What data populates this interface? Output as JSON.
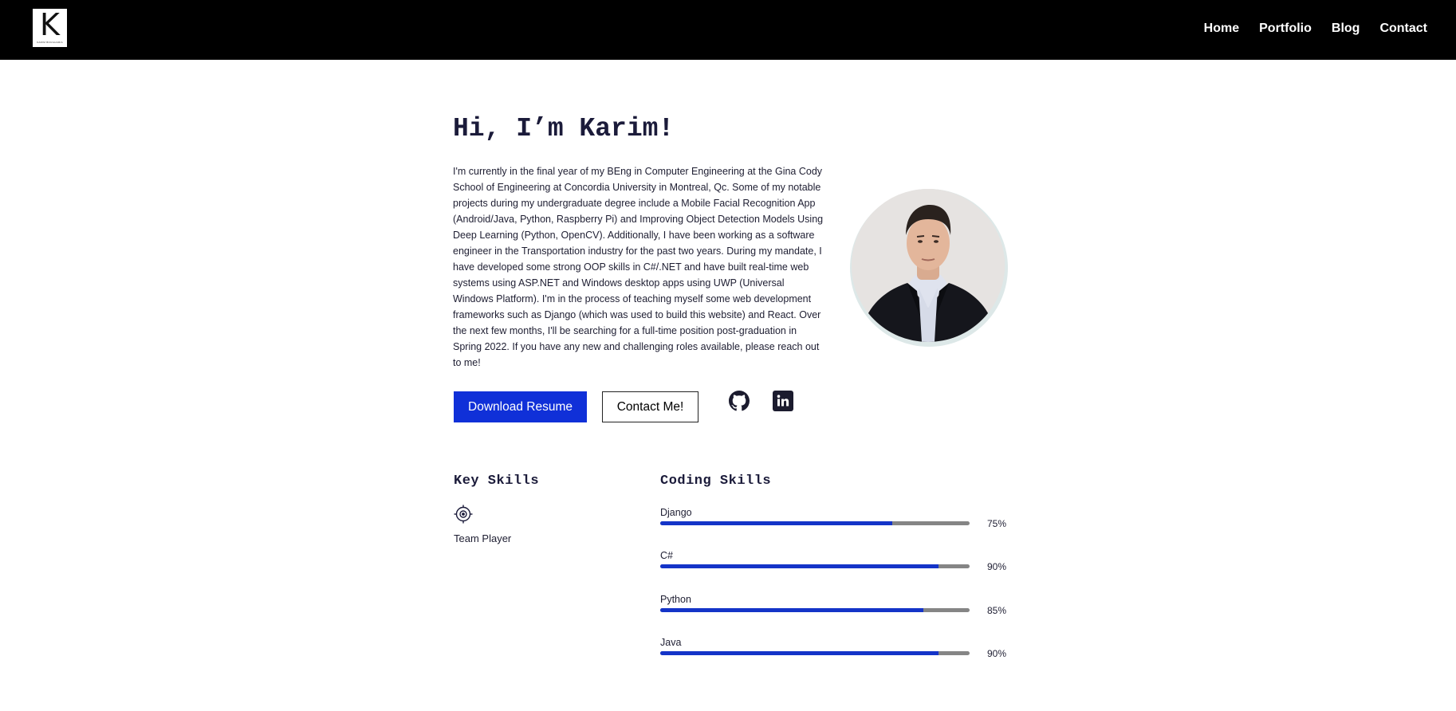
{
  "header": {
    "logo": {
      "letter": "K",
      "subtitle": "KARIM BOUGHARIA"
    },
    "nav": [
      "Home",
      "Portfolio",
      "Blog",
      "Contact"
    ]
  },
  "intro": {
    "title": "Hi, I’m Karim!",
    "bio": "I'm currently in the final year of my BEng in Computer Engineering at the Gina Cody School of Engineering at Concordia University in Montreal, Qc. Some of my notable projects during my undergraduate degree include a Mobile Facial Recognition App (Android/Java, Python, Raspberry Pi) and Improving Object Detection Models Using Deep Learning (Python, OpenCV). Additionally, I have been working as a software engineer in the Transportation industry for the past two years. During my mandate, I have developed some strong OOP skills in C#/.NET and have built real-time web systems using ASP.NET and Windows desktop apps using UWP (Universal Windows Platform). I'm in the process of teaching myself some web development frameworks such as Django (which was used to build this website) and React. Over the next few months, I'll be searching for a full-time position post-graduation in Spring 2022. If you have any new and challenging roles available, please reach out to me!",
    "buttons": {
      "download": "Download Resume",
      "contact": "Contact Me!"
    },
    "social_icons": [
      "github-icon",
      "linkedin-icon"
    ]
  },
  "key_skills": {
    "title": "Key Skills",
    "items": [
      {
        "icon": "target-icon",
        "label": "Team Player"
      }
    ]
  },
  "coding_skills": {
    "title": "Coding Skills",
    "items": [
      {
        "name": "Django",
        "percent": 75,
        "percent_label": "75%"
      },
      {
        "name": "C#",
        "percent": 90,
        "percent_label": "90%"
      },
      {
        "name": "Python",
        "percent": 85,
        "percent_label": "85%"
      },
      {
        "name": "Java",
        "percent": 90,
        "percent_label": "90%"
      }
    ]
  },
  "colors": {
    "header_bg": "#000000",
    "primary": "#1030d8",
    "bar_track": "#858585",
    "heading": "#1b1b3a"
  }
}
